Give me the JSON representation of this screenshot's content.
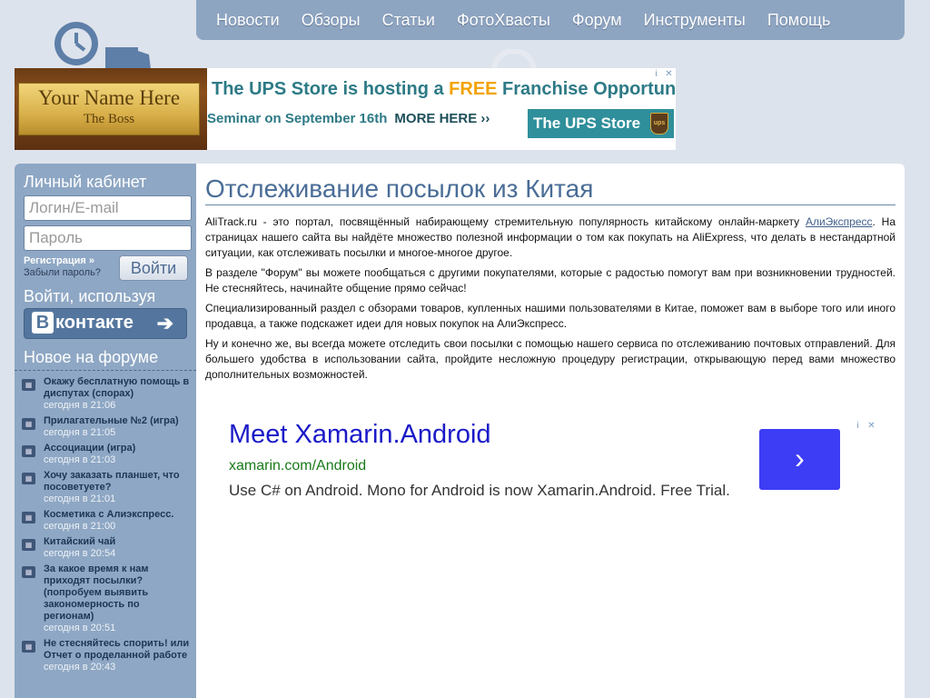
{
  "nav": {
    "items": [
      "Новости",
      "Обзоры",
      "Статьи",
      "ФотоХвасты",
      "Форум",
      "Инструменты",
      "Помощь"
    ]
  },
  "ad_top": {
    "plate_line1": "Your Name Here",
    "plate_line2": "The Boss",
    "headline_a": "The UPS Store is hosting a ",
    "headline_free": "FREE",
    "headline_b": " Franchise Opportunity",
    "seminar": "Seminar on September 16th",
    "more": "MORE HERE ››",
    "brand": "The UPS Store",
    "brand_logo": "ups",
    "info": "i",
    "close": "✕"
  },
  "sidebar": {
    "account_title": "Личный кабинет",
    "login_placeholder": "Логин/E-mail",
    "password_placeholder": "Пароль",
    "register": "Регистрация »",
    "forgot": "Забыли пароль?",
    "login_button": "Войти",
    "login_via": "Войти, используя",
    "vk_letter": "В",
    "vk_label": "контакте",
    "vk_arrow": "➔",
    "forum_title": "Новое на форуме",
    "forum_items": [
      {
        "title": "Окажу бесплатную помощь в диспутах (спорах)",
        "date": "сегодня в 21:06"
      },
      {
        "title": "Прилагательные №2 (игра)",
        "date": "сегодня в 21:05"
      },
      {
        "title": "Ассоциации (игра)",
        "date": "сегодня в 21:03"
      },
      {
        "title": "Хочу заказать планшет, что посоветуете?",
        "date": "сегодня в 21:01"
      },
      {
        "title": "Косметика с Алиэкспресс.",
        "date": "сегодня в 21:00"
      },
      {
        "title": "Китайский чай",
        "date": "сегодня в 20:54"
      },
      {
        "title": "За какое время к нам приходят посылки? (попробуем выявить закономерность по регионам)",
        "date": "сегодня в 20:51"
      },
      {
        "title": "Не стесняйтесь спорить! или Отчет о проделанной работе",
        "date": "сегодня в 20:43"
      }
    ]
  },
  "main": {
    "title": "Отслеживание посылок из Китая",
    "p1_a": "AliTrack.ru - это портал, посвящённый набирающему стремительную популярность китайскому онлайн-маркету ",
    "p1_link": "АлиЭкспресс",
    "p1_b": ". На страницах нашего сайта вы найдёте множество полезной информации о том как покупать на AliExpress, что делать в нестандартной ситуации, как отслеживать посылки и многое-многое другое.",
    "p2": "В разделе \"Форум\" вы можете пообщаться с другими покупателями, которые с радостью помогут вам при возникновении трудностей. Не стесняйтесь, начинайте общение прямо сейчас!",
    "p3": "Специализированный раздел с обзорами товаров, купленных нашими пользователями в Китае, поможет вам в выборе того или иного продавца, а также подскажет идеи для новых покупок на АлиЭкспресс.",
    "p4": "Ну и конечно же, вы всегда можете отследить свои посылки с помощью нашего сервиса по отслеживанию почтовых отправлений. Для большего удобства в использовании сайта, пройдите несложную процедуру регистрации, открывающую перед вами множество дополнительных возможностей."
  },
  "ad_bottom": {
    "headline": "Meet Xamarin.Android",
    "url": "xamarin.com/Android",
    "desc": "Use C# on Android. Mono for Android is now Xamarin.Android. Free Trial.",
    "go": "›",
    "info": "i",
    "close": "✕"
  },
  "colors": {
    "nav_bg": "#8ea5c2",
    "sidebar_bg": "#8ea7c4",
    "title_color": "#4a6d97",
    "page_bg": "#dde3ec"
  }
}
